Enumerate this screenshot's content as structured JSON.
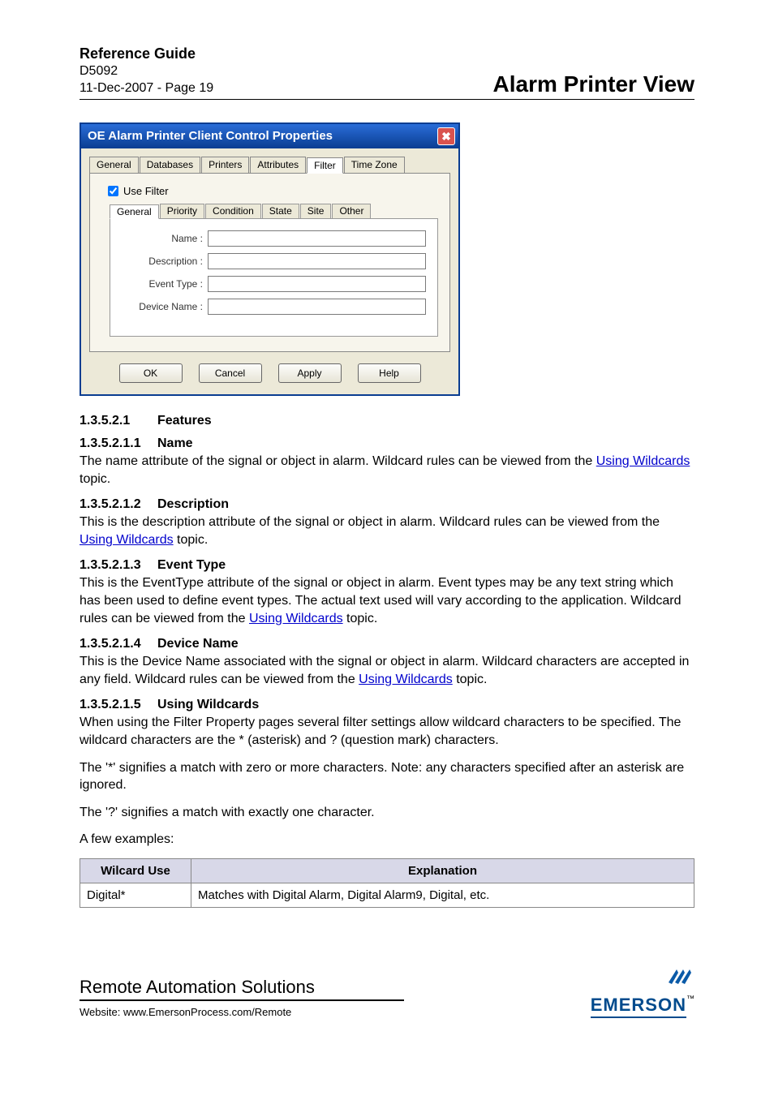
{
  "header": {
    "ref_title": "Reference Guide",
    "doc_id": "D5092",
    "date_page": "11-Dec-2007 - Page 19",
    "page_title": "Alarm Printer View"
  },
  "dialog": {
    "title": "OE Alarm Printer Client Control Properties",
    "close_glyph": "✖",
    "tabs": [
      "General",
      "Databases",
      "Printers",
      "Attributes",
      "Filter",
      "Time Zone"
    ],
    "active_tab_index": 4,
    "use_filter_label": "Use Filter",
    "use_filter_checked": true,
    "subtabs": [
      "General",
      "Priority",
      "Condition",
      "State",
      "Site",
      "Other"
    ],
    "active_subtab_index": 0,
    "fields": [
      {
        "label": "Name :",
        "value": ""
      },
      {
        "label": "Description :",
        "value": ""
      },
      {
        "label": "Event Type :",
        "value": ""
      },
      {
        "label": "Device Name :",
        "value": ""
      }
    ],
    "buttons": [
      "OK",
      "Cancel",
      "Apply",
      "Help"
    ]
  },
  "sections": {
    "features": {
      "num": "1.3.5.2.1",
      "title": "Features"
    },
    "name": {
      "num": "1.3.5.2.1.1",
      "title": "Name",
      "pre": "The name attribute of the signal or object in alarm. Wildcard rules can be viewed from the ",
      "link": "Using Wildcards",
      "post": " topic."
    },
    "description": {
      "num": "1.3.5.2.1.2",
      "title": "Description",
      "pre": "This is the description attribute of the signal or object in alarm. Wildcard rules can be viewed from the ",
      "link": "Using Wildcards",
      "post": " topic."
    },
    "eventtype": {
      "num": "1.3.5.2.1.3",
      "title": "Event Type",
      "pre": "This is the EventType attribute of the signal or object in alarm. Event types may be any text string which has been used to define event types. The actual text used will vary according to the application. Wildcard rules can be viewed from the ",
      "link": "Using Wildcards",
      "post": " topic."
    },
    "devicename": {
      "num": "1.3.5.2.1.4",
      "title": "Device Name",
      "pre": "This is the Device Name associated with the signal or object in alarm. Wildcard characters are accepted in any field. Wildcard rules can be viewed from the ",
      "link": "Using Wildcards",
      "post": " topic."
    },
    "wildcards": {
      "num": "1.3.5.2.1.5",
      "title": "Using Wildcards",
      "p1": "When using the Filter Property pages several filter settings allow wildcard characters to be specified. The wildcard characters are the * (asterisk) and ? (question mark) characters.",
      "p2": "The '*' signifies a match with zero or more characters. Note: any characters specified after an asterisk are ignored.",
      "p3": "The '?' signifies a match with exactly one character.",
      "p4": "A few examples:"
    }
  },
  "table": {
    "headers": [
      "Wilcard Use",
      "Explanation"
    ],
    "rows": [
      [
        "Digital*",
        "Matches with Digital Alarm, Digital Alarm9, Digital, etc."
      ]
    ]
  },
  "footer": {
    "ras": "Remote Automation Solutions",
    "site_label": "Website:  www.EmersonProcess.com/Remote",
    "logo_text": "EMERSON",
    "logo_tm": "™"
  }
}
